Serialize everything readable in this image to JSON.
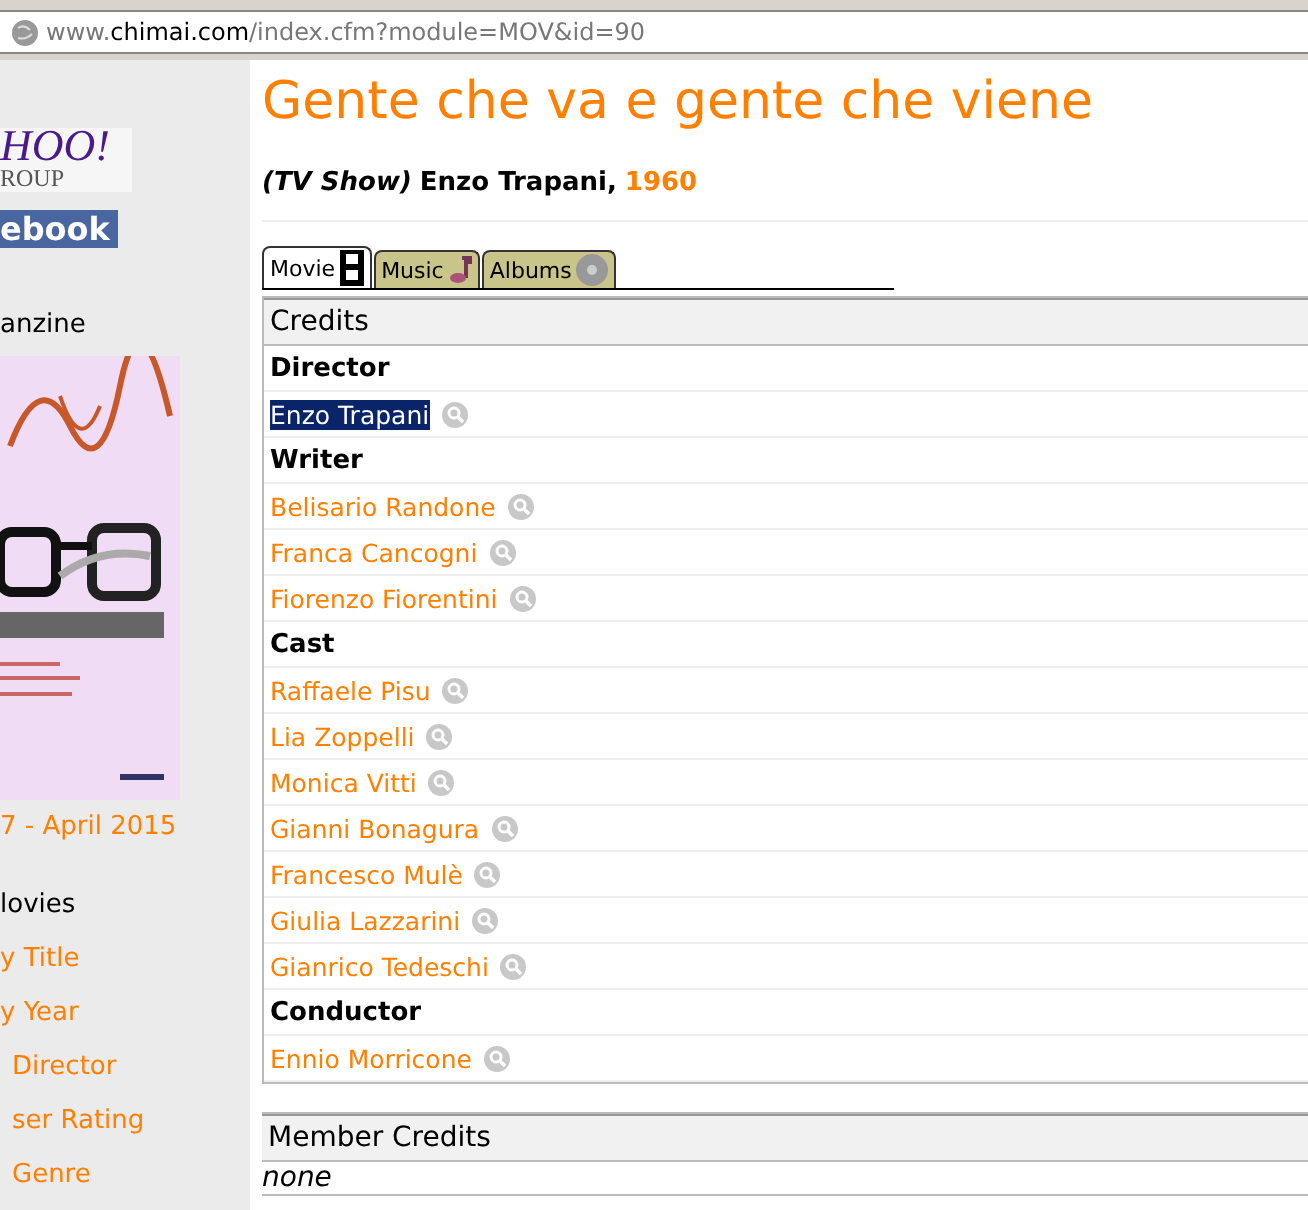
{
  "address_bar": {
    "url_prefix": "www.",
    "url_domain": "chimai.com",
    "url_path": "/index.cfm?module=MOV&id=90"
  },
  "sidebar": {
    "logos": [
      {
        "kind": "yahoo",
        "lines": [
          "HOO!",
          "ROUP"
        ]
      },
      {
        "kind": "facebook",
        "lines": [
          "ebook"
        ]
      }
    ],
    "magazine_heading": "anzine",
    "issue_link": "7 - April 2015",
    "movies_heading": "lovies",
    "links": [
      "y Title",
      "y Year",
      "Director",
      "ser Rating",
      "Genre"
    ]
  },
  "title": "Gente che va e gente che viene",
  "subtitle": {
    "type": "(TV Show)",
    "director": "Enzo Trapani,",
    "year": "1960"
  },
  "tabs": [
    {
      "label": "Movie",
      "kind": "film",
      "selected": true
    },
    {
      "label": "Music",
      "kind": "note",
      "selected": false
    },
    {
      "label": "Albums",
      "kind": "disc",
      "selected": false
    }
  ],
  "credits": {
    "heading": "Credits",
    "rows": [
      {
        "kind": "role",
        "text": "Director"
      },
      {
        "kind": "person",
        "text": "Enzo Trapani",
        "selected": true
      },
      {
        "kind": "role",
        "text": "Writer"
      },
      {
        "kind": "person",
        "text": "Belisario Randone",
        "selected": false
      },
      {
        "kind": "person",
        "text": "Franca Cancogni",
        "selected": false
      },
      {
        "kind": "person",
        "text": "Fiorenzo Fiorentini",
        "selected": false
      },
      {
        "kind": "role",
        "text": "Cast"
      },
      {
        "kind": "person",
        "text": "Raffaele Pisu",
        "selected": false
      },
      {
        "kind": "person",
        "text": "Lia Zoppelli",
        "selected": false
      },
      {
        "kind": "person",
        "text": "Monica Vitti",
        "selected": false
      },
      {
        "kind": "person",
        "text": "Gianni Bonagura",
        "selected": false
      },
      {
        "kind": "person",
        "text": "Francesco Mulè",
        "selected": false
      },
      {
        "kind": "person",
        "text": "Giulia Lazzarini",
        "selected": false
      },
      {
        "kind": "person",
        "text": "Gianrico Tedeschi",
        "selected": false
      },
      {
        "kind": "role",
        "text": "Conductor"
      },
      {
        "kind": "person",
        "text": "Ennio Morricone",
        "selected": false
      }
    ]
  },
  "member_credits": {
    "heading": "Member Credits",
    "text": "none"
  }
}
